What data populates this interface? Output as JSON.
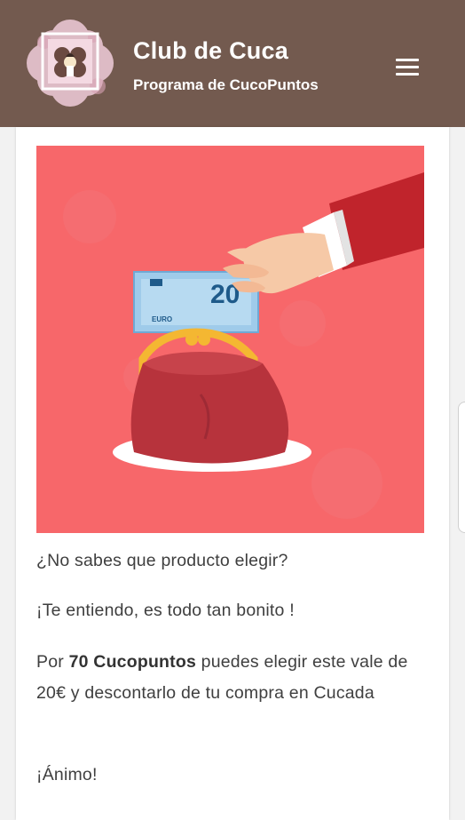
{
  "header": {
    "title": "Club de Cuca",
    "subtitle": "Programa de CucoPuntos",
    "menu_icon": "hamburger-menu-icon"
  },
  "hero": {
    "icon": "hand-euro-purse-illustration",
    "banknote_value": "20",
    "banknote_currency": "EURO",
    "background_color": "#f7676a"
  },
  "content": {
    "p1": "¿No sabes que producto elegir?",
    "p2": "¡Te entiendo, es todo tan bonito !",
    "p3_prefix": "Por ",
    "p3_bold": "70 Cucopuntos",
    "p3_suffix": " puedes elegir este vale de 20€ y descontarlo de tu compra en Cucada",
    "p4": "¡Ánimo!"
  },
  "colors": {
    "header_bg": "#735a4f",
    "card_bg": "#ffffff",
    "page_bg": "#f2f2f2",
    "text": "#3f3f3f"
  }
}
